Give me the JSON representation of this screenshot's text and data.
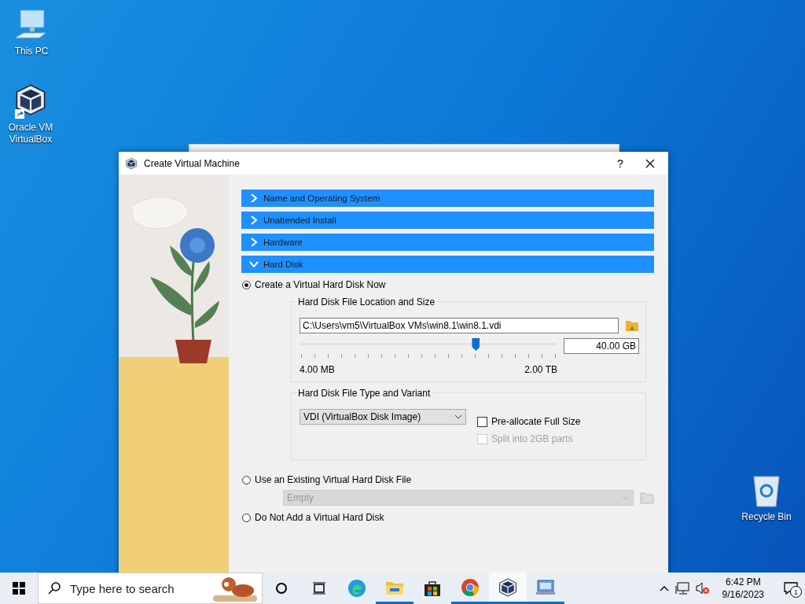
{
  "desktop_icons": [
    {
      "kind": "pc",
      "label": "This PC"
    },
    {
      "kind": "vbox",
      "label": "Oracle VM VirtualBox"
    },
    {
      "kind": "bin",
      "label": "Recycle Bin"
    }
  ],
  "dialog": {
    "title": "Create Virtual Machine",
    "help": "?",
    "sections": [
      {
        "label": "Name and Operating System",
        "expanded": false
      },
      {
        "label": "Unattended Install",
        "expanded": false
      },
      {
        "label": "Hardware",
        "expanded": false
      },
      {
        "label": "Hard Disk",
        "expanded": true
      }
    ],
    "options": [
      {
        "label": "Create a Virtual Hard Disk Now",
        "selected": true
      },
      {
        "label": "Use an Existing Virtual Hard Disk File",
        "selected": false
      },
      {
        "label": "Do Not Add a Virtual Hard Disk",
        "selected": false
      }
    ],
    "location_group": {
      "title": "Hard Disk File Location and Size",
      "path": "C:\\Users\\vm5\\VirtualBox VMs\\win8.1\\win8.1.vdi",
      "size": "40.00 GB",
      "level": 0.69,
      "min_label": "4.00 MB",
      "max_label": "2.00 TB"
    },
    "type_group": {
      "title": "Hard Disk File Type and Variant",
      "format": "VDI (VirtualBox Disk Image)",
      "checkboxes": [
        {
          "label": "Pre-allocate Full Size",
          "checked": false,
          "disabled": false
        },
        {
          "label": "Split into 2GB parts",
          "checked": false,
          "disabled": true
        }
      ]
    },
    "existing_file": {
      "value": "Empty",
      "disabled": true
    }
  },
  "taskbar": {
    "search_placeholder": "Type here to search",
    "apps": [
      {
        "kind": "cortana",
        "running": false,
        "active": false
      },
      {
        "kind": "taskview",
        "running": false,
        "active": false
      },
      {
        "kind": "edge",
        "running": false,
        "active": false
      },
      {
        "kind": "explorer",
        "running": true,
        "active": false
      },
      {
        "kind": "store",
        "running": false,
        "active": false
      },
      {
        "kind": "chrome",
        "running": true,
        "active": false
      },
      {
        "kind": "vbox",
        "running": true,
        "active": true
      },
      {
        "kind": "remote",
        "running": true,
        "active": false
      }
    ],
    "time": "6:42 PM",
    "date": "9/16/2023",
    "notifications": "1"
  }
}
